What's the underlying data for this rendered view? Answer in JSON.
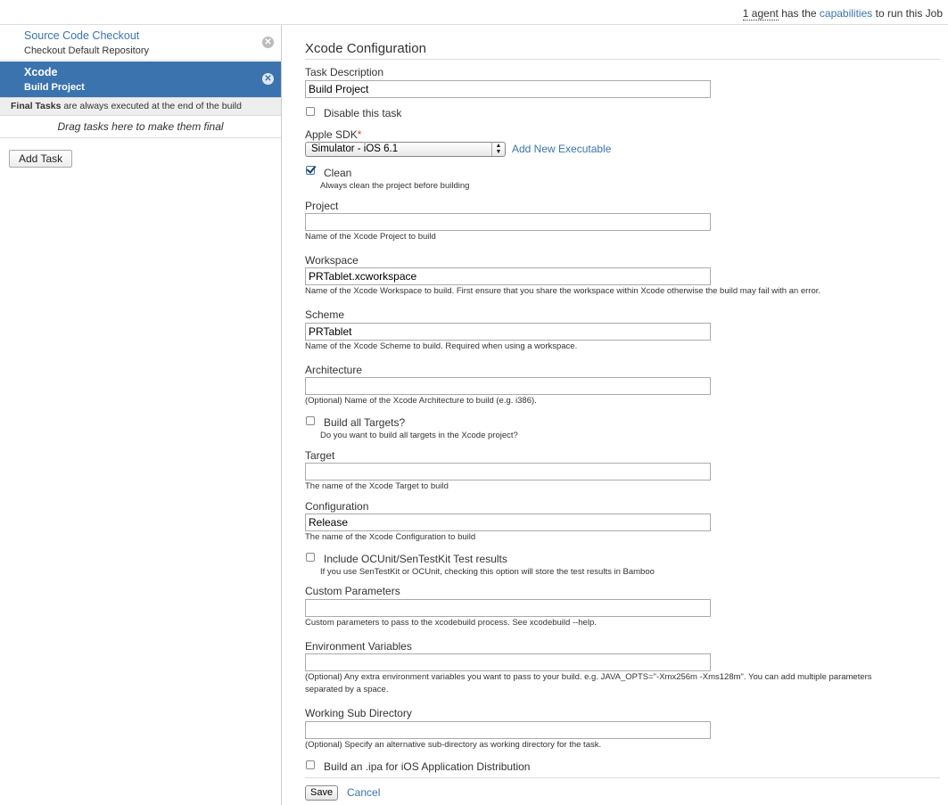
{
  "topbar": {
    "agents_count": "1 agent",
    "has_the": "has the",
    "capabilities": "capabilities",
    "to_run": "to run this Job"
  },
  "sidebar": {
    "tasks": [
      {
        "title": "Source Code Checkout",
        "subtitle": "Checkout Default Repository"
      },
      {
        "title": "Xcode",
        "subtitle": "Build Project"
      }
    ],
    "final_tasks_bold": "Final Tasks",
    "final_tasks_rest": "are always executed at the end of the build",
    "drag_hint": "Drag tasks here to make them final",
    "add_task": "Add Task"
  },
  "form": {
    "heading": "Xcode Configuration",
    "task_description_label": "Task Description",
    "task_description_value": "Build Project",
    "disable_label": "Disable this task",
    "sdk_label": "Apple SDK",
    "sdk_required": "*",
    "sdk_value": "Simulator - iOS 6.1",
    "add_executable": "Add New Executable",
    "clean_label": "Clean",
    "clean_desc": "Always clean the project before building",
    "clean_checked": true,
    "project_label": "Project",
    "project_value": "",
    "project_desc": "Name of the Xcode Project to build",
    "workspace_label": "Workspace",
    "workspace_value": "PRTablet.xcworkspace",
    "workspace_desc": "Name of the Xcode Workspace to build. First ensure that you share the workspace within Xcode otherwise the build may fail with an error.",
    "scheme_label": "Scheme",
    "scheme_value": "PRTablet",
    "scheme_desc": "Name of the Xcode Scheme to build. Required when using a workspace.",
    "architecture_label": "Architecture",
    "architecture_value": "",
    "architecture_desc": "(Optional) Name of the Xcode Architecture to build (e.g. i386).",
    "build_all_label": "Build all Targets?",
    "build_all_desc": "Do you want to build all targets in the Xcode project?",
    "target_label": "Target",
    "target_value": "",
    "target_desc": "The name of the Xcode Target to build",
    "configuration_label": "Configuration",
    "configuration_value": "Release",
    "configuration_desc": "The name of the Xcode Configuration to build",
    "ocunit_label": "Include OCUnit/SenTestKit Test results",
    "ocunit_desc": "If you use SenTestKit or OCUnit, checking this option will store the test results in Bamboo",
    "custom_params_label": "Custom Parameters",
    "custom_params_value": "",
    "custom_params_desc": "Custom parameters to pass to the xcodebuild process. See xcodebuild --help.",
    "env_label": "Environment Variables",
    "env_value": "",
    "env_desc_1": "(Optional) Any extra environment variables you want to pass to your build. e.g. JAVA_OPTS=\"-Xmx256m -Xms128m\". You can add multiple parameters",
    "env_desc_2": "separated by a space.",
    "subdir_label": "Working Sub Directory",
    "subdir_value": "",
    "subdir_desc": "(Optional) Specify an alternative sub-directory as working directory for the task.",
    "ipa_label": "Build an .ipa for iOS Application Distribution",
    "save": "Save",
    "cancel": "Cancel"
  },
  "colors": {
    "accent": "#3b73af",
    "required": "#d04437"
  }
}
